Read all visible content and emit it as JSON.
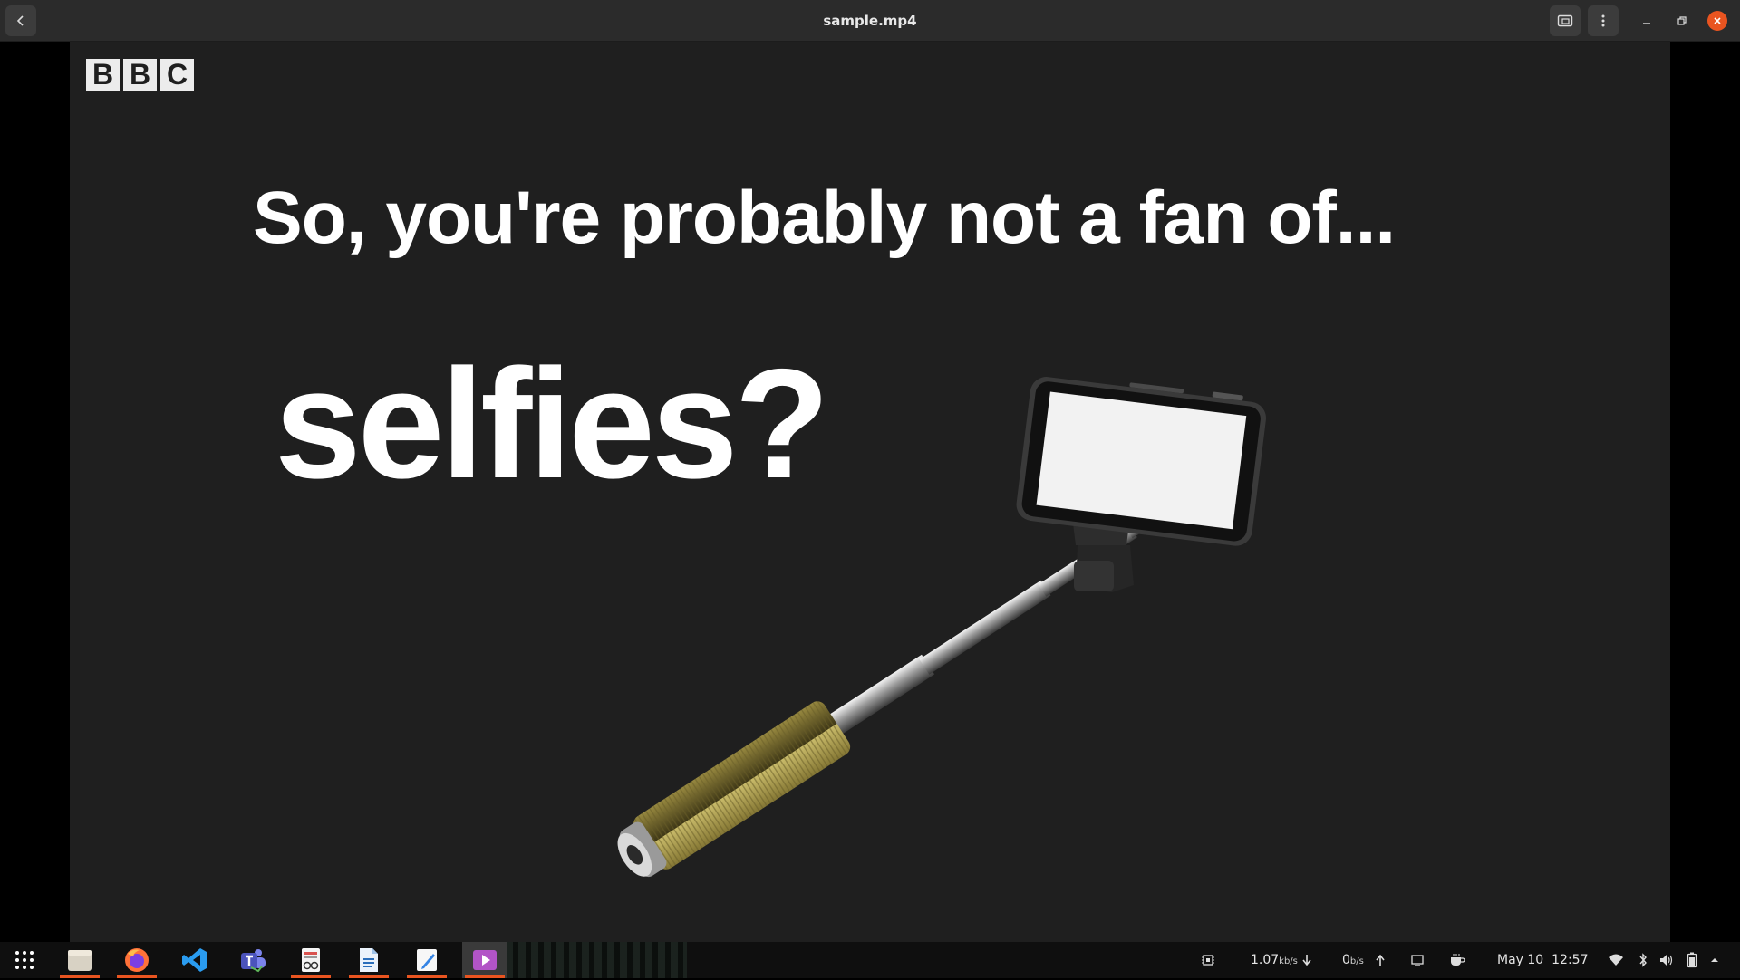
{
  "window": {
    "title": "sample.mp4"
  },
  "video": {
    "logo_letters": [
      "B",
      "B",
      "C"
    ],
    "headline": "So, you're probably not a fan of...",
    "big_word": "selfies?"
  },
  "taskbar": {
    "apps": [
      {
        "name": "app-grid",
        "running": false
      },
      {
        "name": "files",
        "running": true
      },
      {
        "name": "firefox",
        "running": true
      },
      {
        "name": "vscode",
        "running": false
      },
      {
        "name": "teams",
        "running": false
      },
      {
        "name": "document-viewer",
        "running": true
      },
      {
        "name": "writer",
        "running": true
      },
      {
        "name": "text-editor",
        "running": true
      },
      {
        "name": "video-player",
        "running": true,
        "active": true
      }
    ],
    "net_down": "1.07",
    "net_down_unit": "kb/s",
    "net_up": "0",
    "net_up_unit": "b/s",
    "date": "May 10",
    "time": "12:57"
  },
  "colors": {
    "accent": "#e95420",
    "titlebar": "#2b2b2b",
    "video_bg": "#1f1f1f"
  }
}
